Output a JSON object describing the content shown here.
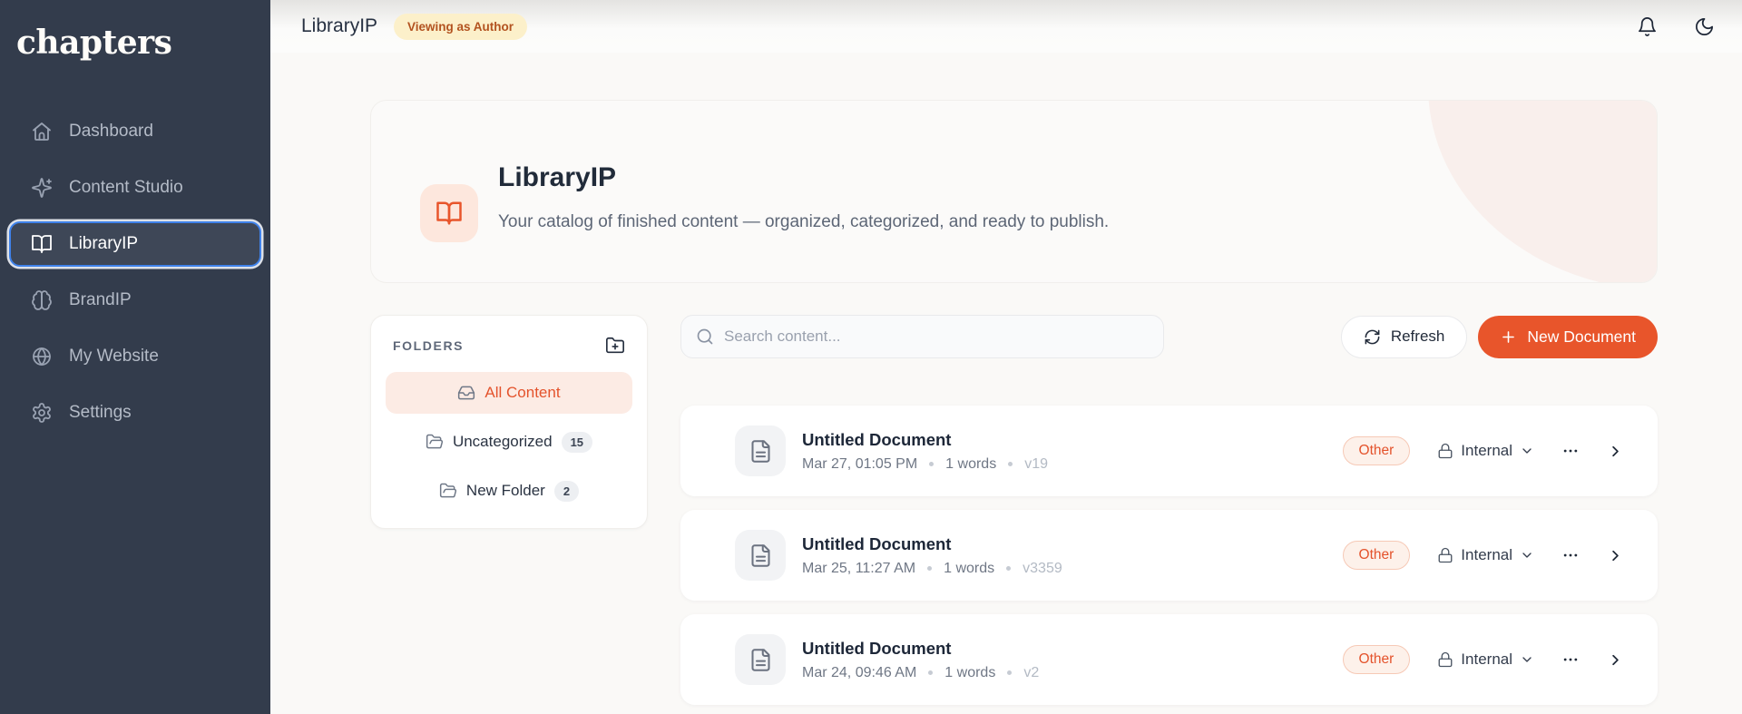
{
  "brand": {
    "logo": "chapters"
  },
  "sidebar": {
    "items": [
      {
        "label": "Dashboard",
        "icon": "home-icon",
        "active": false
      },
      {
        "label": "Content Studio",
        "icon": "sparkles-icon",
        "active": false
      },
      {
        "label": "LibraryIP",
        "icon": "book-open-icon",
        "active": true
      },
      {
        "label": "BrandIP",
        "icon": "brain-icon",
        "active": false
      },
      {
        "label": "My Website",
        "icon": "globe-icon",
        "active": false
      },
      {
        "label": "Settings",
        "icon": "gear-icon",
        "active": false
      }
    ]
  },
  "topbar": {
    "title": "LibraryIP",
    "badge": "Viewing as Author",
    "icons": [
      "bell-icon",
      "moon-icon"
    ]
  },
  "hero": {
    "title": "LibraryIP",
    "description": "Your catalog of finished content — organized, categorized, and ready to publish.",
    "icon": "book-open-icon"
  },
  "folders": {
    "heading": "FOLDERS",
    "add_icon": "folder-plus-icon",
    "items": [
      {
        "label": "All Content",
        "icon": "inbox-icon",
        "count": "",
        "active": true
      },
      {
        "label": "Uncategorized",
        "icon": "folder-icon",
        "count": "15",
        "active": false
      },
      {
        "label": "New Folder",
        "icon": "folder-icon",
        "count": "2",
        "active": false
      }
    ]
  },
  "toolbar": {
    "search_placeholder": "Search content...",
    "refresh_label": "Refresh",
    "new_document_label": "New Document"
  },
  "documents": [
    {
      "title": "Untitled Document",
      "date": "Mar 27, 01:05 PM",
      "words": "1 words",
      "version": "v19",
      "category": "Other",
      "visibility": "Internal"
    },
    {
      "title": "Untitled Document",
      "date": "Mar 25, 11:27 AM",
      "words": "1 words",
      "version": "v3359",
      "category": "Other",
      "visibility": "Internal"
    },
    {
      "title": "Untitled Document",
      "date": "Mar 24, 09:46 AM",
      "words": "1 words",
      "version": "v2",
      "category": "Other",
      "visibility": "Internal"
    }
  ],
  "colors": {
    "accent": "#e8552b",
    "sidebar_bg": "#333c4c",
    "active_nav_border": "#3f82ea",
    "author_badge_bg": "#fcf0ca",
    "author_badge_text": "#b35320",
    "active_folder_bg": "#fcebe4",
    "category_badge_bg": "#fdf1ea",
    "page_bg": "#faf9f7"
  }
}
